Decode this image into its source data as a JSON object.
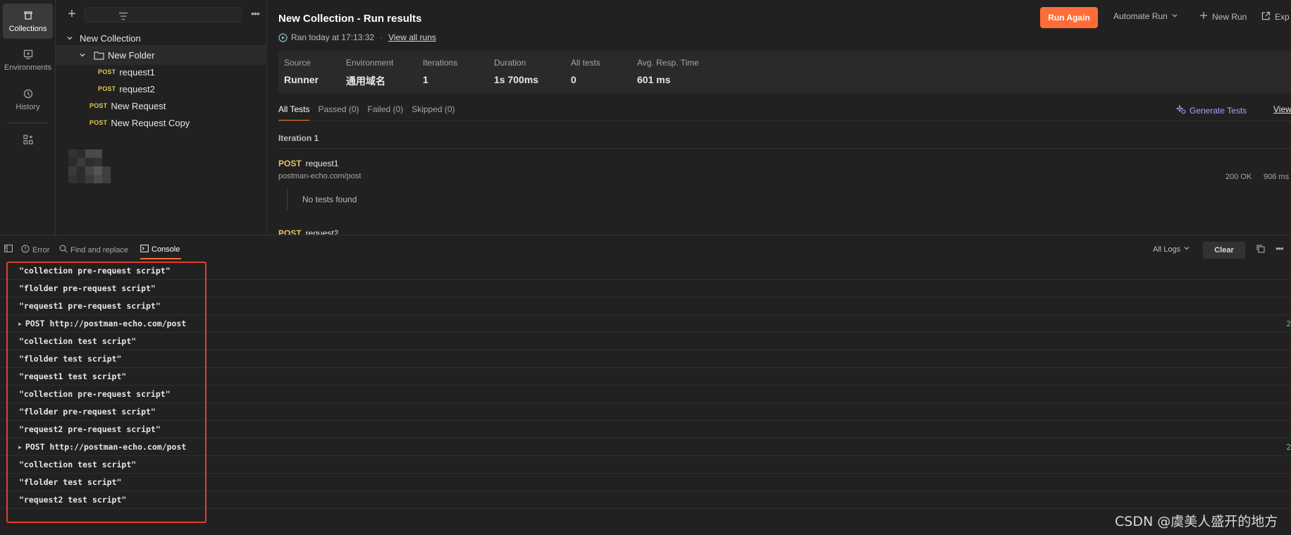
{
  "rail": {
    "items": [
      {
        "label": "Collections",
        "icon": "collections-icon",
        "active": true
      },
      {
        "label": "Environments",
        "icon": "environments-icon",
        "active": false
      },
      {
        "label": "History",
        "icon": "history-icon",
        "active": false
      }
    ]
  },
  "sidebar": {
    "tree": [
      {
        "label": "New Collection",
        "kind": "collection"
      },
      {
        "label": "New Folder",
        "kind": "folder"
      },
      {
        "label": "request1",
        "method": "POST"
      },
      {
        "label": "request2",
        "method": "POST"
      },
      {
        "label": "New Request",
        "method": "POST"
      },
      {
        "label": "New Request Copy",
        "method": "POST"
      }
    ]
  },
  "header": {
    "title": "New Collection - Run results",
    "ran_text": "Ran today at 17:13:32",
    "view_all_runs": "View all runs",
    "run_again": "Run Again",
    "automate_run": "Automate Run",
    "new_run": "New Run",
    "export": "Exp"
  },
  "stats": [
    {
      "label": "Source",
      "value": "Runner"
    },
    {
      "label": "Environment",
      "value": "通用域名"
    },
    {
      "label": "Iterations",
      "value": "1"
    },
    {
      "label": "Duration",
      "value": "1s 700ms"
    },
    {
      "label": "All tests",
      "value": "0"
    },
    {
      "label": "Avg. Resp. Time",
      "value": "601 ms"
    }
  ],
  "tabs": [
    {
      "label": "All Tests",
      "active": true
    },
    {
      "label": "Passed (0)",
      "active": false
    },
    {
      "label": "Failed (0)",
      "active": false
    },
    {
      "label": "Skipped (0)",
      "active": false
    }
  ],
  "generate_tests": "Generate Tests",
  "view_link": "View",
  "iteration_label": "Iteration 1",
  "requests": [
    {
      "method": "POST",
      "name": "request1",
      "url": "postman-echo.com/post",
      "status": "200 OK",
      "time": "906 ms",
      "no_tests": "No tests found"
    },
    {
      "method": "POST",
      "name": "request2"
    }
  ],
  "console": {
    "tabs": [
      {
        "label": "Error",
        "icon": "error-icon"
      },
      {
        "label": "Find and replace",
        "icon": "search-icon"
      },
      {
        "label": "Console",
        "icon": "console-icon",
        "active": true
      }
    ],
    "all_logs": "All Logs",
    "clear": "Clear",
    "logs": [
      {
        "text": "\"collection pre-request script\""
      },
      {
        "text": "\"flolder pre-request script\""
      },
      {
        "text": "\"request1 pre-request script\""
      },
      {
        "text": "POST http://postman-echo.com/post",
        "expandable": true,
        "trail": "2"
      },
      {
        "text": "\"collection test script\""
      },
      {
        "text": "\"flolder test script\""
      },
      {
        "text": "\"request1 test script\""
      },
      {
        "text": "\"collection pre-request script\""
      },
      {
        "text": "\"flolder pre-request script\""
      },
      {
        "text": "\"request2 pre-request script\""
      },
      {
        "text": "POST http://postman-echo.com/post",
        "expandable": true,
        "trail": "2"
      },
      {
        "text": "\"collection test script\""
      },
      {
        "text": "\"flolder test script\""
      },
      {
        "text": "\"request2 test script\""
      }
    ]
  },
  "watermark": "CSDN @虞美人盛开的地方",
  "colors": {
    "accent": "#ff6c37",
    "method": "#e6c35a",
    "highlight": "#e53b2f",
    "generate": "#b59dff"
  }
}
